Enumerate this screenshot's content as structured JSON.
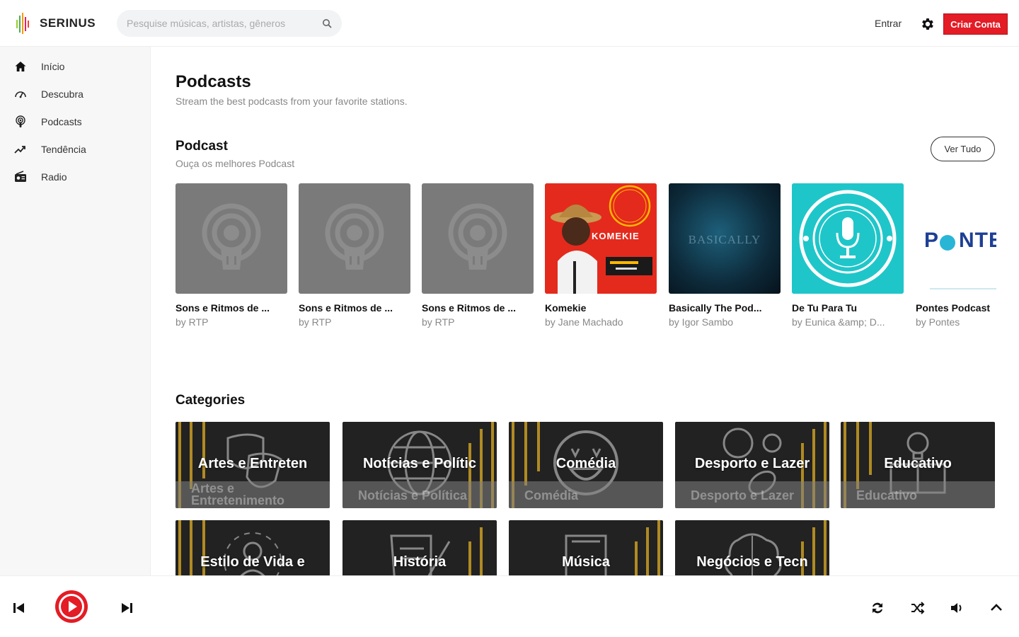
{
  "app": {
    "name": "SERINUS",
    "brand_color": "#e31c25"
  },
  "header": {
    "search_placeholder": "Pesquise músicas, artistas, gêneros",
    "login_label": "Entrar",
    "create_account_label": "Criar Conta"
  },
  "sidebar": {
    "items": [
      {
        "label": "Início",
        "icon": "home-icon"
      },
      {
        "label": "Descubra",
        "icon": "discover-icon"
      },
      {
        "label": "Podcasts",
        "icon": "podcast-icon"
      },
      {
        "label": "Tendência",
        "icon": "trending-icon"
      },
      {
        "label": "Radio",
        "icon": "radio-icon"
      }
    ]
  },
  "page": {
    "title": "Podcasts",
    "subtitle": "Stream the best podcasts from your favorite stations."
  },
  "podcast_section": {
    "title": "Podcast",
    "subtitle": "Ouça os melhores Podcast",
    "see_all_label": "Ver Tudo",
    "items": [
      {
        "title": "Sons e Ritmos de ...",
        "author": "by RTP"
      },
      {
        "title": "Sons e Ritmos de ...",
        "author": "by RTP"
      },
      {
        "title": "Sons e Ritmos de ...",
        "author": "by RTP"
      },
      {
        "title": "Komekie",
        "author": "by Jane Machado"
      },
      {
        "title": "Basically The Pod...",
        "author": "by Igor Sambo"
      },
      {
        "title": "De Tu Para Tu",
        "author": "by Eunica &amp; D..."
      },
      {
        "title": "Pontes Podcast",
        "author": "by Pontes"
      }
    ]
  },
  "categories": {
    "title": "Categories",
    "items": [
      {
        "name": "Artes e Entreten",
        "label": "Artes e Entretenimento"
      },
      {
        "name": "Notícias e Polític",
        "label": "Notícias e Política"
      },
      {
        "name": "Comédia",
        "label": "Comédia"
      },
      {
        "name": "Desporto e Lazer",
        "label": "Desporto e Lazer"
      },
      {
        "name": "Educativo",
        "label": "Educativo"
      },
      {
        "name": "Estilo de Vida e",
        "label": ""
      },
      {
        "name": "História",
        "label": ""
      },
      {
        "name": "Música",
        "label": ""
      },
      {
        "name": "Negócios e Tecn",
        "label": ""
      }
    ]
  }
}
